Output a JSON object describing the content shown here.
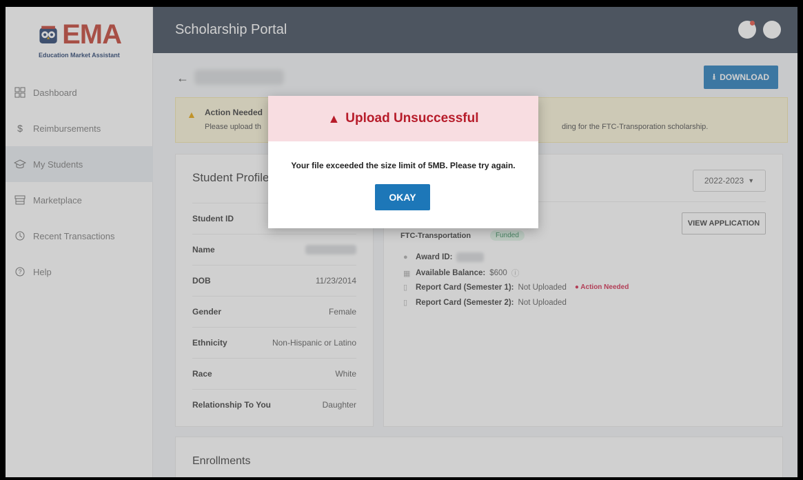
{
  "logo": {
    "text": "EMA",
    "subtitle": "Education Market Assistant"
  },
  "topbar": {
    "title": "Scholarship Portal"
  },
  "sidebar": {
    "items": [
      {
        "label": "Dashboard",
        "icon": "grid-icon"
      },
      {
        "label": "Reimbursements",
        "icon": "dollar-icon"
      },
      {
        "label": "My Students",
        "icon": "graduation-cap-icon",
        "active": true
      },
      {
        "label": "Marketplace",
        "icon": "store-icon"
      },
      {
        "label": "Recent Transactions",
        "icon": "history-icon"
      },
      {
        "label": "Help",
        "icon": "help-icon"
      }
    ]
  },
  "header": {
    "download_label": "DOWNLOAD"
  },
  "alert": {
    "title": "Action Needed",
    "body": "Please upload th",
    "body_tail": "ding for the FTC-Transporation scholarship."
  },
  "profile": {
    "title": "Student Profile",
    "rows": [
      {
        "label": "Student ID",
        "value": ""
      },
      {
        "label": "Name",
        "value": ""
      },
      {
        "label": "DOB",
        "value": "11/23/2014"
      },
      {
        "label": "Gender",
        "value": "Female"
      },
      {
        "label": "Ethnicity",
        "value": "Non-Hispanic or Latino"
      },
      {
        "label": "Race",
        "value": "White"
      },
      {
        "label": "Relationship To You",
        "value": "Daughter"
      }
    ]
  },
  "award": {
    "year": "2022-2023",
    "scholarship": "FTC-Transportation",
    "status": "Funded",
    "view_application_label": "VIEW APPLICATION",
    "award_id_label": "Award ID:",
    "balance_label": "Available Balance:",
    "balance_value": "$600",
    "report1_label": "Report Card (Semester 1):",
    "report1_value": "Not Uploaded",
    "report1_badge": "Action Needed",
    "report2_label": "Report Card (Semester 2):",
    "report2_value": "Not Uploaded"
  },
  "enrollments": {
    "title": "Enrollments"
  },
  "modal": {
    "title": "Upload Unsuccessful",
    "message": "Your file exceeded the size limit of 5MB. Please try again.",
    "button": "OKAY"
  },
  "colors": {
    "topbar": "#374354",
    "primary": "#1d77b8",
    "error": "#b71c2a",
    "error_bg": "#f8dde1"
  }
}
